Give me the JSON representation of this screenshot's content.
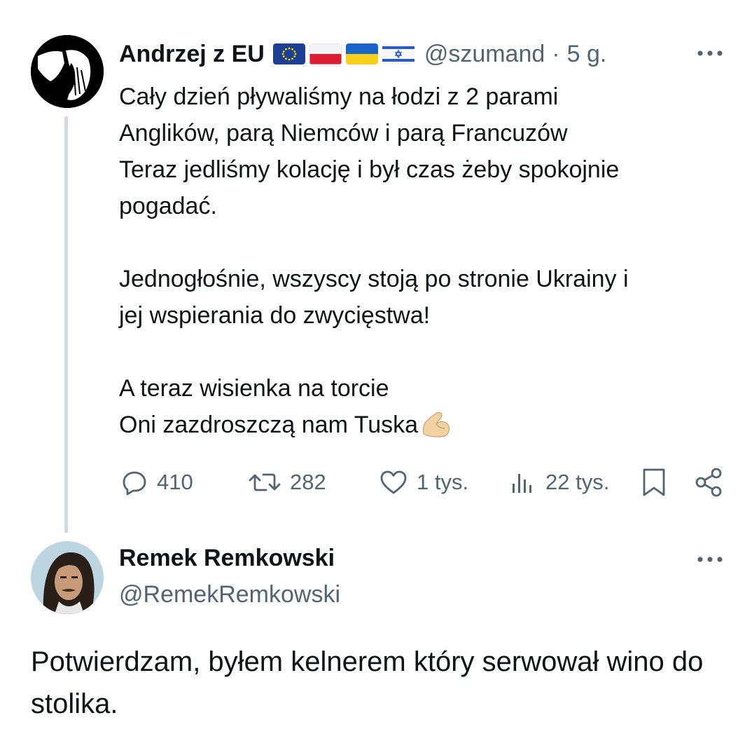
{
  "tweet": {
    "author": {
      "display_name": "Andrzej z EU",
      "flags": [
        "eu-flag-icon",
        "poland-flag-icon",
        "ukraine-flag-icon",
        "israel-flag-icon"
      ],
      "handle": "@szumand",
      "separator": "·",
      "time": "5 g."
    },
    "text": "Cały dzień pływaliśmy na łodzi z 2 parami\nAnglików, parą Niemców i parą Francuzów\nTeraz jedliśmy kolację i był czas żeby spokojnie\npogadać.\n\nJednogłośnie, wszyscy stoją po stronie Ukrainy i\njej wspierania do zwycięstwa!\n\nA teraz wisienka na torcie\nOni zazdroszczą nam Tuska",
    "text_emoji": "flexed-biceps-icon",
    "actions": {
      "replies": "410",
      "reposts": "282",
      "likes": "1 tys.",
      "views": "22 tys."
    }
  },
  "reply": {
    "author": {
      "display_name": "Remek Remkowski",
      "handle": "@RemekRemkowski"
    },
    "text": "Potwierdzam, byłem kelnerem który serwował wino do stolika."
  },
  "colors": {
    "text_primary": "#0f1419",
    "text_secondary": "#536471",
    "thread_line": "#cfd9de"
  }
}
